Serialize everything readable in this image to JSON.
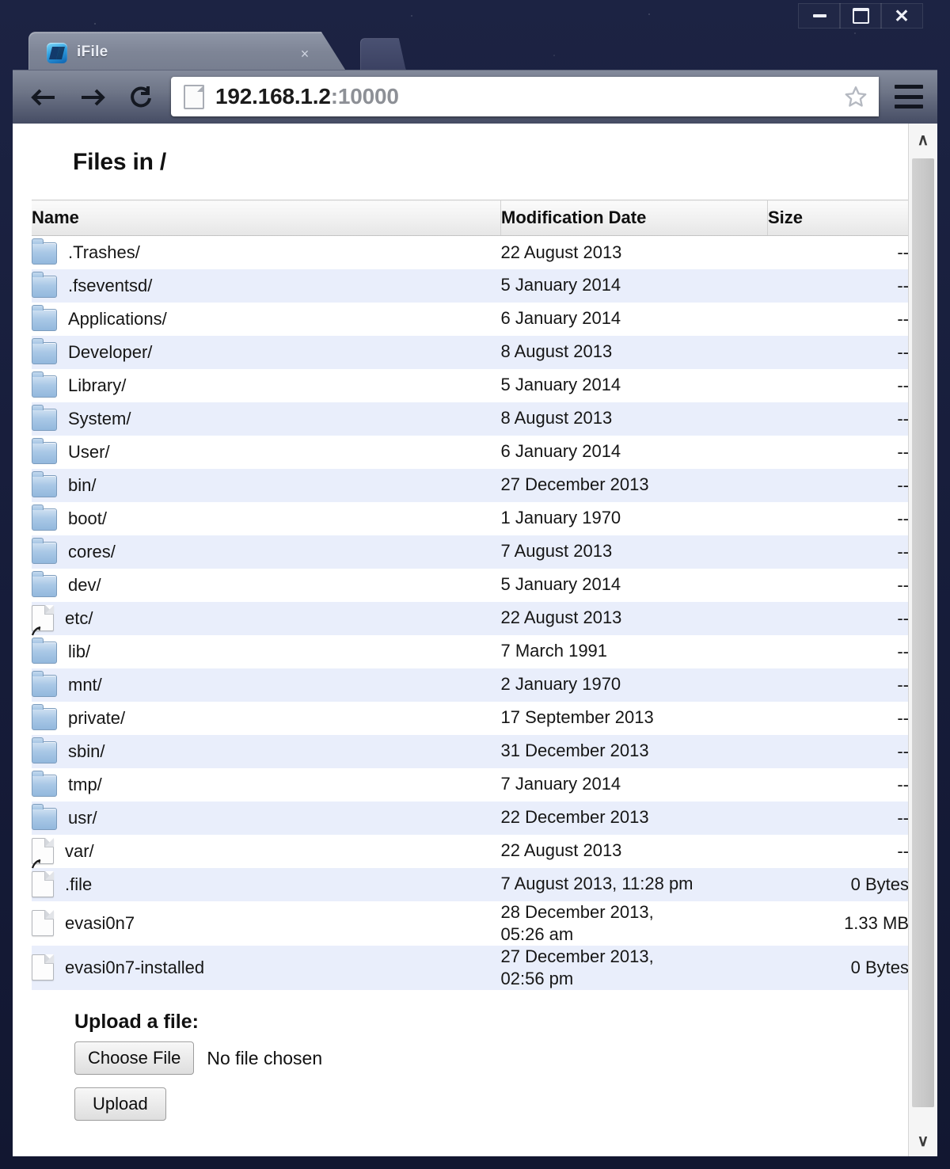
{
  "window": {
    "controls": {
      "minimize": "minimize",
      "maximize": "maximize",
      "close": "close"
    }
  },
  "browser": {
    "tab": {
      "title": "iFile",
      "close_label": "×",
      "favicon": "ifile-app-icon"
    },
    "nav": {
      "back": "back-arrow-icon",
      "forward": "forward-arrow-icon",
      "reload": "reload-icon"
    },
    "omnibox": {
      "page_icon": "page-document-icon",
      "url_host": "192.168.1.2",
      "url_port": ":10000",
      "bookmark": "star-icon"
    },
    "menu": "hamburger-menu-icon"
  },
  "page": {
    "title": "Files in /",
    "table": {
      "headers": {
        "name": "Name",
        "date": "Modification Date",
        "size": "Size"
      },
      "rows": [
        {
          "name": ".Trashes/",
          "date": "22 August 2013",
          "size": "--",
          "icon": "folder"
        },
        {
          "name": ".fseventsd/",
          "date": "5 January 2014",
          "size": "--",
          "icon": "folder"
        },
        {
          "name": "Applications/",
          "date": "6 January 2014",
          "size": "--",
          "icon": "folder"
        },
        {
          "name": "Developer/",
          "date": "8 August 2013",
          "size": "--",
          "icon": "folder"
        },
        {
          "name": "Library/",
          "date": "5 January 2014",
          "size": "--",
          "icon": "folder"
        },
        {
          "name": "System/",
          "date": "8 August 2013",
          "size": "--",
          "icon": "folder"
        },
        {
          "name": "User/",
          "date": "6 January 2014",
          "size": "--",
          "icon": "folder"
        },
        {
          "name": "bin/",
          "date": "27 December 2013",
          "size": "--",
          "icon": "folder"
        },
        {
          "name": "boot/",
          "date": "1 January 1970",
          "size": "--",
          "icon": "folder"
        },
        {
          "name": "cores/",
          "date": "7 August 2013",
          "size": "--",
          "icon": "folder"
        },
        {
          "name": "dev/",
          "date": "5 January 2014",
          "size": "--",
          "icon": "folder"
        },
        {
          "name": "etc/",
          "date": "22 August 2013",
          "size": "--",
          "icon": "alias"
        },
        {
          "name": "lib/",
          "date": "7 March 1991",
          "size": "--",
          "icon": "folder"
        },
        {
          "name": "mnt/",
          "date": "2 January 1970",
          "size": "--",
          "icon": "folder"
        },
        {
          "name": "private/",
          "date": "17 September 2013",
          "size": "--",
          "icon": "folder"
        },
        {
          "name": "sbin/",
          "date": "31 December 2013",
          "size": "--",
          "icon": "folder"
        },
        {
          "name": "tmp/",
          "date": "7 January 2014",
          "size": "--",
          "icon": "folder"
        },
        {
          "name": "usr/",
          "date": "22 December 2013",
          "size": "--",
          "icon": "folder"
        },
        {
          "name": "var/",
          "date": "22 August 2013",
          "size": "--",
          "icon": "alias"
        },
        {
          "name": ".file",
          "date": "7 August 2013, 11:28 pm",
          "size": "0 Bytes",
          "icon": "doc"
        },
        {
          "name": "evasi0n7",
          "date": "28 December 2013,\n05:26 am",
          "size": "1.33 MB",
          "icon": "doc",
          "tall": true
        },
        {
          "name": "evasi0n7-installed",
          "date": "27 December 2013,\n02:56 pm",
          "size": "0 Bytes",
          "icon": "doc",
          "tall": true
        }
      ]
    },
    "upload": {
      "label": "Upload a file:",
      "choose_button": "Choose File",
      "no_file_text": "No file chosen",
      "upload_button": "Upload"
    },
    "scrollbar": {
      "up": "∧",
      "down": "∨"
    }
  },
  "colors": {
    "window_frame": "#161c39",
    "toolbar": "#6e7587",
    "row_stripe": "#e9eefb",
    "row_base": "#ffffff",
    "folder_icon": "#a9c8e6"
  }
}
